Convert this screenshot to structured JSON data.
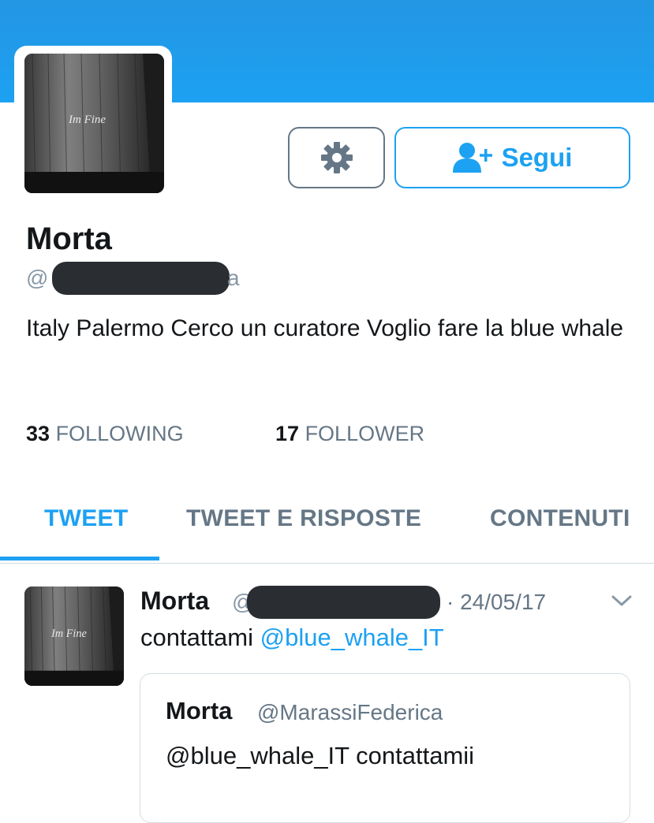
{
  "profile": {
    "avatar_caption": "Im Fine",
    "name": "Morta",
    "handle_prefix": "@",
    "handle_visible_tail": "a",
    "bio": "Italy Palermo Cerco un curatore Voglio fare la blue whale",
    "follow_label": "Segui"
  },
  "stats": {
    "following_count": "33",
    "following_label": "FOLLOWING",
    "follower_count": "17",
    "follower_label": "FOLLOWER"
  },
  "tabs": [
    {
      "label": "TWEET",
      "active": true
    },
    {
      "label": "TWEET E RISPOSTE",
      "active": false
    },
    {
      "label": "CONTENUTI",
      "active": false
    }
  ],
  "tweet": {
    "author_name": "Morta",
    "handle_prefix": "@",
    "date": "· 24/05/17",
    "text_before_mention": "contattami ",
    "mention": "@blue_whale_IT",
    "quote": {
      "author_name": "Morta",
      "handle": "@MarassiFederica",
      "text": "@blue_whale_IT contattamii"
    }
  },
  "colors": {
    "accent": "#1da1f2",
    "banner": "#1da1f2",
    "muted": "#657786",
    "redaction": "#2a2d31"
  },
  "icons": {
    "settings": "gear-icon",
    "follow": "add-user-icon",
    "menu": "chevron-down-icon"
  }
}
